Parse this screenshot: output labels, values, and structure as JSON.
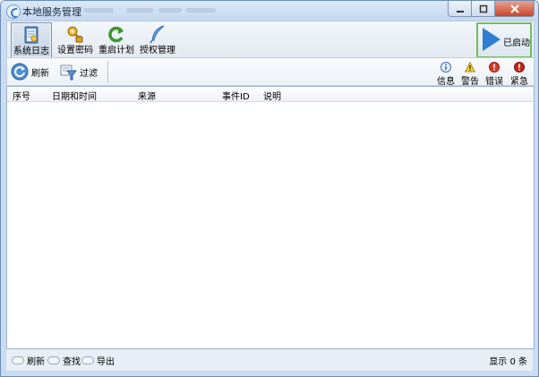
{
  "window": {
    "title": "本地服务管理"
  },
  "toolbar": {
    "syslog": "系统日志",
    "set_password": "设置密码",
    "restart_plan": "重启计划",
    "auth_manage": "授权管理",
    "status_button": "已启动"
  },
  "filterbar": {
    "refresh": "刷新",
    "filter": "过滤",
    "levels": {
      "info": "信息",
      "warning": "警告",
      "error": "错误",
      "critical": "紧急"
    }
  },
  "table": {
    "columns": [
      "序号",
      "日期和时间",
      "来源",
      "事件ID",
      "说明"
    ],
    "rows": []
  },
  "statusbar": {
    "refresh": "刷新",
    "find": "查找",
    "export": "导出",
    "count_text": "显示 0 条"
  },
  "colors": {
    "accent": "#2d7ed3",
    "started_border": "#6fbf5b",
    "window_border": "#6d8db3"
  }
}
